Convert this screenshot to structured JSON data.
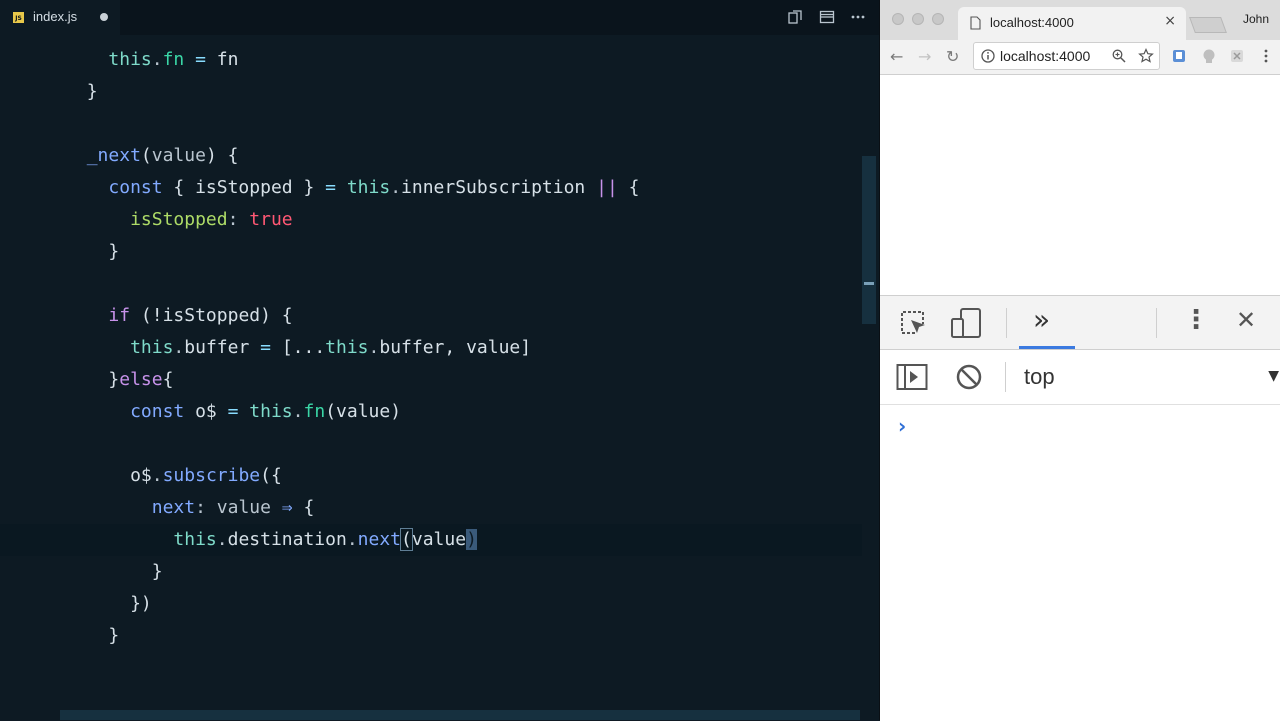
{
  "editor": {
    "tab": {
      "icon_label": "JS",
      "filename": "index.js",
      "dirty_indicator": "●"
    },
    "toolbar_icons": [
      "compare-icon",
      "split-editor-icon",
      "more-icon"
    ],
    "code_lines": [
      {
        "indent": "    ",
        "tokens": [
          {
            "t": "this",
            "c": "th"
          },
          {
            "t": ".",
            "c": "pm"
          },
          {
            "t": "fn",
            "c": "fnr"
          },
          {
            "t": " = ",
            "c": "op"
          },
          {
            "t": "fn",
            "c": "pl"
          }
        ]
      },
      {
        "indent": "  ",
        "tokens": [
          {
            "t": "}",
            "c": "pl"
          }
        ]
      },
      {
        "indent": "",
        "tokens": []
      },
      {
        "indent": "  ",
        "tokens": [
          {
            "t": "_next",
            "c": "fnc"
          },
          {
            "t": "(",
            "c": "pl"
          },
          {
            "t": "value",
            "c": "pm"
          },
          {
            "t": ") {",
            "c": "pl"
          }
        ]
      },
      {
        "indent": "    ",
        "tokens": [
          {
            "t": "const",
            "c": "fnc"
          },
          {
            "t": " { isStopped } ",
            "c": "pl"
          },
          {
            "t": "=",
            "c": "op"
          },
          {
            "t": " ",
            "c": "pl"
          },
          {
            "t": "this",
            "c": "th"
          },
          {
            "t": ".",
            "c": "pm"
          },
          {
            "t": "innerSubscription",
            "c": "pl"
          },
          {
            "t": " ",
            "c": "pl"
          },
          {
            "t": "||",
            "c": "kw"
          },
          {
            "t": " {",
            "c": "pl"
          }
        ]
      },
      {
        "indent": "      ",
        "tokens": [
          {
            "t": "isStopped",
            "c": "pr"
          },
          {
            "t": ": ",
            "c": "pm"
          },
          {
            "t": "true",
            "c": "bool"
          }
        ]
      },
      {
        "indent": "    ",
        "tokens": [
          {
            "t": "}",
            "c": "pl"
          }
        ]
      },
      {
        "indent": "",
        "tokens": []
      },
      {
        "indent": "    ",
        "tokens": [
          {
            "t": "if",
            "c": "kw"
          },
          {
            "t": " (!isStopped) {",
            "c": "pl"
          }
        ]
      },
      {
        "indent": "      ",
        "tokens": [
          {
            "t": "this",
            "c": "th"
          },
          {
            "t": ".",
            "c": "pm"
          },
          {
            "t": "buffer",
            "c": "pl"
          },
          {
            "t": " = ",
            "c": "op"
          },
          {
            "t": "[...",
            "c": "pl"
          },
          {
            "t": "this",
            "c": "th"
          },
          {
            "t": ".",
            "c": "pm"
          },
          {
            "t": "buffer, value]",
            "c": "pl"
          }
        ]
      },
      {
        "indent": "    ",
        "tokens": [
          {
            "t": "}",
            "c": "pl"
          },
          {
            "t": "else",
            "c": "kw"
          },
          {
            "t": "{",
            "c": "pl"
          }
        ]
      },
      {
        "indent": "      ",
        "tokens": [
          {
            "t": "const",
            "c": "fnc"
          },
          {
            "t": " o$ ",
            "c": "pl"
          },
          {
            "t": "=",
            "c": "op"
          },
          {
            "t": " ",
            "c": "pl"
          },
          {
            "t": "this",
            "c": "th"
          },
          {
            "t": ".",
            "c": "pm"
          },
          {
            "t": "fn",
            "c": "fnr"
          },
          {
            "t": "(value)",
            "c": "pl"
          }
        ]
      },
      {
        "indent": "",
        "tokens": []
      },
      {
        "indent": "      ",
        "tokens": [
          {
            "t": "o$",
            "c": "pl"
          },
          {
            "t": ".",
            "c": "pm"
          },
          {
            "t": "subscribe",
            "c": "fnc"
          },
          {
            "t": "({",
            "c": "pl"
          }
        ]
      },
      {
        "indent": "        ",
        "tokens": [
          {
            "t": "next",
            "c": "fnc"
          },
          {
            "t": ": ",
            "c": "pm"
          },
          {
            "t": "value",
            "c": "pm"
          },
          {
            "t": " ⇒ ",
            "c": "fnc"
          },
          {
            "t": "{",
            "c": "pl"
          }
        ]
      },
      {
        "indent": "          ",
        "active": true,
        "tokens": [
          {
            "t": "this",
            "c": "th"
          },
          {
            "t": ".",
            "c": "pm"
          },
          {
            "t": "destination",
            "c": "pl"
          },
          {
            "t": ".",
            "c": "pm"
          },
          {
            "t": "next",
            "c": "fnc"
          },
          {
            "t": "(",
            "c": "bracket-box"
          },
          {
            "t": "value",
            "c": "pl"
          },
          {
            "t": ")",
            "c": "caret-box"
          }
        ]
      },
      {
        "indent": "        ",
        "tokens": [
          {
            "t": "}",
            "c": "pl"
          }
        ]
      },
      {
        "indent": "      ",
        "tokens": [
          {
            "t": "})",
            "c": "pl"
          }
        ]
      },
      {
        "indent": "    ",
        "tokens": [
          {
            "t": "}",
            "c": "pl"
          }
        ]
      }
    ]
  },
  "browser": {
    "tab_title": "localhost:4000",
    "tab_close": "×",
    "user_name": "John",
    "url": "localhost:4000",
    "nav_back": "←",
    "nav_forward": "→",
    "nav_reload": "↻",
    "devtools": {
      "more_tabs": "»",
      "menu": "⋮",
      "close": "✕",
      "context": "top",
      "context_arrow": "▼",
      "prompt": "›"
    }
  }
}
